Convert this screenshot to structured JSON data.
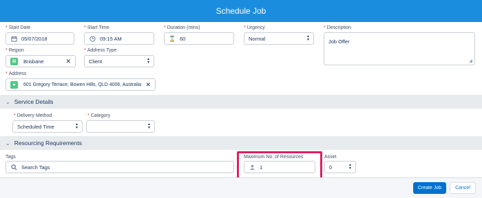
{
  "header": {
    "title": "Schedule Job"
  },
  "fields": {
    "start_date": {
      "label": "Start Date",
      "value": "05/07/2018",
      "icon": "calendar-icon"
    },
    "start_time": {
      "label": "Start Time",
      "value": "09:15 AM",
      "icon": "clock-icon"
    },
    "duration": {
      "label": "Duration (mins)",
      "value": "60",
      "icon": "hourglass-icon"
    },
    "urgency": {
      "label": "Urgency",
      "value": "Normal"
    },
    "description": {
      "label": "Description",
      "value": "Job Offer"
    },
    "region": {
      "label": "Region",
      "value": "Brisbane"
    },
    "address_type": {
      "label": "Address Type",
      "value": "Client"
    },
    "address": {
      "label": "Address",
      "value": "601 Gregory Terrace, Bowen Hills, QLD 4006, Australia"
    }
  },
  "service_details": {
    "title": "Service Details",
    "delivery_method": {
      "label": "Delivery Method",
      "value": "Scheduled Time"
    },
    "category": {
      "label": "Category",
      "value": ""
    }
  },
  "resourcing": {
    "title": "Resourcing Requirements",
    "tags": {
      "label": "Tags",
      "placeholder": "Search Tags"
    },
    "max_resources": {
      "label": "Maximum No. of Resources",
      "value": "1"
    },
    "asset": {
      "label": "Asset",
      "value": "0"
    }
  },
  "footer": {
    "create_label": "Create Job",
    "cancel_label": "Cancel"
  },
  "colors": {
    "header": "#1b8dde",
    "primary": "#0070d2",
    "highlight": "#e11d63",
    "pill": "#4bca81"
  }
}
